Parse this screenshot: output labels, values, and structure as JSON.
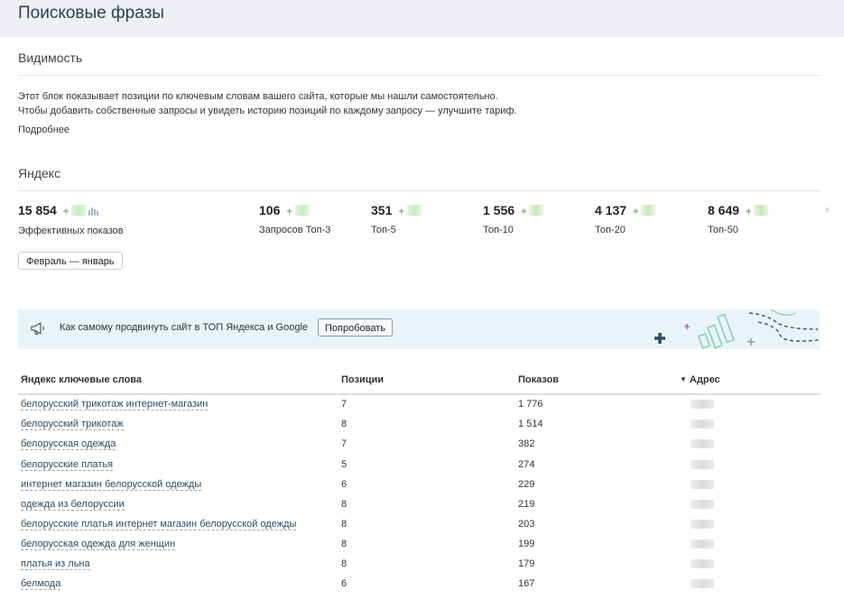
{
  "page": {
    "title": "Поисковые фразы"
  },
  "visibility": {
    "title": "Видимость",
    "line1": "Этот блок показывает позиции по ключевым словам вашего сайта, которые мы нашли самостоятельно.",
    "line2": "Чтобы добавить собственные запросы и увидеть историю позиций по каждому запросу — улучшите тариф.",
    "more_link": "Подробнее"
  },
  "yandex": {
    "title": "Яндекс",
    "stats": [
      {
        "value": "15 854",
        "plus": "+",
        "label": "Эффективных показов"
      },
      {
        "value": "106",
        "plus": "+",
        "label": "Запросов Топ-3"
      },
      {
        "value": "351",
        "plus": "+",
        "label": "Топ-5"
      },
      {
        "value": "1 556",
        "plus": "+",
        "label": "Топ-10"
      },
      {
        "value": "4 137",
        "plus": "+",
        "label": "Топ-20"
      },
      {
        "value": "8 649",
        "plus": "+",
        "label": "Топ-50"
      }
    ],
    "hash_glyph": "#",
    "period_button": "Февраль — январь"
  },
  "promo": {
    "text": "Как самому продвинуть сайт в ТОП Яндекса и Google",
    "button": "Попробовать",
    "icon": "megaphone-icon"
  },
  "table": {
    "headers": {
      "keywords": "Яндекс ключевые слова",
      "positions": "Позиции",
      "impressions": "Показов",
      "sort_arrow": "▼",
      "address": "Адрес"
    },
    "rows": [
      {
        "keyword": "белорусский трикотаж интернет-магазин",
        "position": "7",
        "impressions": "1 776"
      },
      {
        "keyword": "белорусский трикотаж",
        "position": "8",
        "impressions": "1 514"
      },
      {
        "keyword": "белорусская одежда",
        "position": "7",
        "impressions": "382"
      },
      {
        "keyword": "белорусские платья",
        "position": "5",
        "impressions": "274"
      },
      {
        "keyword": "интернет магазин белорусской одежды",
        "position": "6",
        "impressions": "229"
      },
      {
        "keyword": "одежда из белоруссии",
        "position": "8",
        "impressions": "219"
      },
      {
        "keyword": "белорусские платья интернет магазин белорусской одежды",
        "position": "8",
        "impressions": "203"
      },
      {
        "keyword": "белорусская одежда для женщин",
        "position": "8",
        "impressions": "199"
      },
      {
        "keyword": "платья из льна",
        "position": "8",
        "impressions": "179"
      },
      {
        "keyword": "белмода",
        "position": "6",
        "impressions": "167"
      }
    ]
  },
  "colors": {
    "header_bg": "#eef0f3",
    "promo_bg": "#eaf3fa",
    "plus_green": "#7ab070",
    "art_teal": "#2a6b6b",
    "art_green": "#7fd1a3",
    "art_purple": "#9b59b6"
  }
}
